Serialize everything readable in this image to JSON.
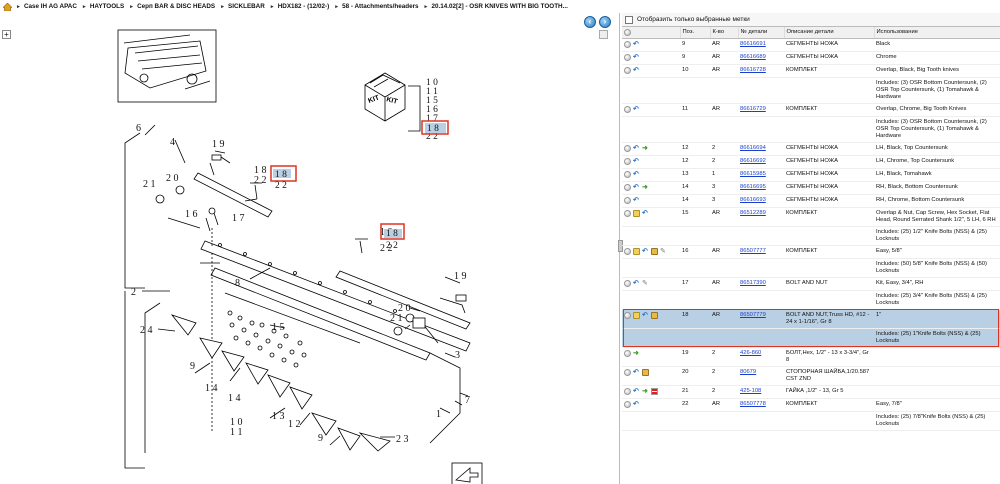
{
  "breadcrumb": {
    "items": [
      "Case IH AG APAC",
      "HAYTOOLS",
      "Серп BAR & DISC HEADS",
      "SICKLEBAR",
      "HDX182 - (12/02-)",
      "58 - Attachments/headers",
      "20.14.02[2] - OSR KNIVES WITH BIG TOOTH..."
    ]
  },
  "filter": {
    "label": "Отобразить только выбранные метки"
  },
  "columns": [
    "Поз.",
    "К-во",
    "№ детали",
    "Описание детали",
    "Использование"
  ],
  "rows": [
    {
      "pos": "9",
      "qty": "AR",
      "part": "86616691",
      "desc": "СЕГМЕНТЫ НОЖА",
      "usage": "Black",
      "icons": [
        "circle",
        "undo"
      ]
    },
    {
      "pos": "9",
      "qty": "AR",
      "part": "86616689",
      "desc": "СЕГМЕНТЫ НОЖА",
      "usage": "Chrome",
      "icons": [
        "circle",
        "undo"
      ]
    },
    {
      "pos": "10",
      "qty": "AR",
      "part": "86616728",
      "desc": "КОМПЛЕКТ",
      "usage": "Overlap, Black, Big Tooth knives",
      "icons": [
        "circle",
        "undo"
      ]
    },
    {
      "sub": "Includes: (3) OSR Bottom Countersunk, (2) OSR Top Countersunk, (1) Tomahawk & Hardware"
    },
    {
      "pos": "11",
      "qty": "AR",
      "part": "86616729",
      "desc": "КОМПЛЕКТ",
      "usage": "Overlap, Chrome, Big Tooth Knives",
      "icons": [
        "circle",
        "undo"
      ]
    },
    {
      "sub": "Includes: (3) OSR Bottom Countersunk, (2) OSR Top Countersunk, (1) Tomahawk & Hardware"
    },
    {
      "pos": "12",
      "qty": "2",
      "part": "86616694",
      "desc": "СЕГМЕНТЫ НОЖА",
      "usage": "LH, Black, Top Countersunk",
      "icons": [
        "circle",
        "undo",
        "go"
      ]
    },
    {
      "pos": "12",
      "qty": "2",
      "part": "86616692",
      "desc": "СЕГМЕНТЫ НОЖА",
      "usage": "LH, Chrome, Top Countersunk",
      "icons": [
        "circle",
        "undo"
      ]
    },
    {
      "pos": "13",
      "qty": "1",
      "part": "86615985",
      "desc": "СЕГМЕНТЫ НОЖА",
      "usage": "LH, Black, Tomahawk",
      "icons": [
        "circle",
        "undo"
      ]
    },
    {
      "pos": "14",
      "qty": "3",
      "part": "86616695",
      "desc": "СЕГМЕНТЫ НОЖА",
      "usage": "RH, Black, Bottom Countersunk",
      "icons": [
        "circle",
        "undo",
        "go"
      ]
    },
    {
      "pos": "14",
      "qty": "3",
      "part": "86616693",
      "desc": "СЕГМЕНТЫ НОЖА",
      "usage": "RH, Chrome, Bottom Countersunk",
      "icons": [
        "circle",
        "undo"
      ]
    },
    {
      "pos": "15",
      "qty": "AR",
      "part": "86512289",
      "desc": "КОМПЛЕКТ",
      "usage": "Overlap & Nut, Cap Screw, Hex Socket, Flat Head, Round Serrated Shank 1/2\", 5 LH, 6 RH",
      "icons": [
        "circle",
        "note",
        "undo"
      ]
    },
    {
      "sub": "Includes: (25) 1/2\" Knife Bolts (NSS) & (25) Locknuts"
    },
    {
      "pos": "16",
      "qty": "AR",
      "part": "86507777",
      "desc": "КОМПЛЕКТ",
      "usage": "Easy, 5/8\"",
      "icons": [
        "circle",
        "note",
        "undo",
        "box",
        "wrench"
      ]
    },
    {
      "sub": "Includes: (50) 5/8\" Knife Bolts (NSS) & (50) Locknuts"
    },
    {
      "pos": "17",
      "qty": "AR",
      "part": "86517390",
      "desc": "BOLT AND NUT",
      "usage": "Kit, Easy, 3/4\", RH",
      "icons": [
        "circle",
        "undo",
        "wrench"
      ]
    },
    {
      "sub": "Includes: (25) 3/4\" Knife Bolts (NSS) & (25) Locknuts"
    },
    {
      "pos": "18",
      "qty": "AR",
      "part": "86507779",
      "desc": "BOLT AND NUT,Truss HD, #12 - 24 x 1-1/16\", Gr 8",
      "usage": "1\"",
      "icons": [
        "circle",
        "note",
        "undo",
        "box"
      ],
      "selected": true
    },
    {
      "sub": "Includes: (25) 1\"Knife Bolts (NSS) & (25) Locknuts",
      "selected": true
    },
    {
      "pos": "19",
      "qty": "2",
      "part": "426-860",
      "desc": "БОЛТ,Hex, 1/2\" - 13 x 3-3/4\", Gr 8",
      "usage": "",
      "icons": [
        "circle",
        "go"
      ]
    },
    {
      "pos": "20",
      "qty": "2",
      "part": "80679",
      "desc": "СТОПОРНАЯ ШАЙБА,1/20.587 CST ZND",
      "usage": "",
      "icons": [
        "circle",
        "undo",
        "box"
      ]
    },
    {
      "pos": "21",
      "qty": "2",
      "part": "425-108",
      "desc": "ГАЙКА ,1/2\" - 13, Gr 5",
      "usage": "",
      "icons": [
        "circle",
        "undo",
        "go",
        "bars"
      ]
    },
    {
      "pos": "22",
      "qty": "AR",
      "part": "86507778",
      "desc": "КОМПЛЕКТ",
      "usage": "Easy, 7/8\"",
      "icons": [
        "circle",
        "undo"
      ]
    },
    {
      "sub": "Includes: (25) 7/8\"Knife Bolts (NSS) & (25) Locknuts"
    }
  ],
  "diagram": {
    "callouts": [
      "1",
      "2",
      "3",
      "4",
      "5",
      "6",
      "7",
      "8",
      "9",
      "10",
      "11",
      "12",
      "13",
      "14",
      "15",
      "16",
      "17",
      "18",
      "19",
      "20",
      "21",
      "22",
      "23"
    ],
    "kit_label": "KIT",
    "kit_numbers": [
      "10",
      "11",
      "15",
      "16",
      "17",
      "18",
      "22"
    ],
    "highlighted": "18"
  }
}
